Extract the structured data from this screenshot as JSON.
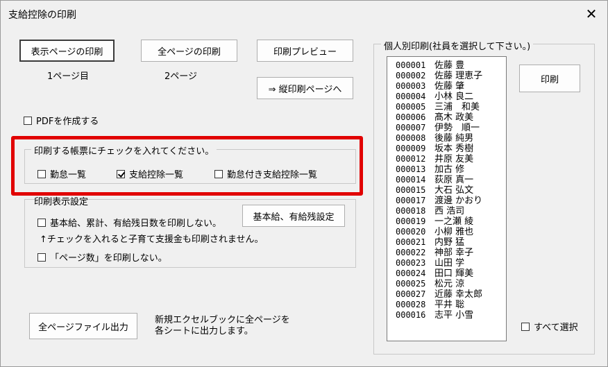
{
  "title": "支給控除の印刷",
  "buttons": {
    "print_displayed": "表示ページの印刷",
    "print_all": "全ページの印刷",
    "preview": "印刷プレビュー",
    "vertical": "⇒ 縦印刷ページへ",
    "print": "印刷",
    "basic_settings": "基本給、有給残設定",
    "export_all": "全ページファイル出力"
  },
  "page_info": {
    "displayed": "1ページ目",
    "total": "2ページ"
  },
  "pdf_checkbox": {
    "label": "PDFを作成する",
    "checked": false
  },
  "report_group": {
    "title": "印刷する帳票にチェックを入れてください。",
    "options": [
      {
        "label": "勤怠一覧",
        "checked": false
      },
      {
        "label": "支給控除一覧",
        "checked": true
      },
      {
        "label": "勤怠付き支給控除一覧",
        "checked": false
      }
    ]
  },
  "display_group": {
    "title": "印刷表示設定",
    "opt1": "基本給、累計、有給残日数を印刷しない。",
    "note": "↑チェックを入れると子育て支援金も印刷されません。",
    "opt2": "「ページ数」を印刷しない。"
  },
  "export_desc": {
    "line1": "新規エクセルブックに全ページを",
    "line2": "各シートに出力します。"
  },
  "employee_group": {
    "title": "個人別印刷(社員を選択して下さい。)",
    "select_all": "すべて選択",
    "employees": [
      {
        "code": "000001",
        "name": "佐藤 豊"
      },
      {
        "code": "000002",
        "name": "佐藤 理恵子"
      },
      {
        "code": "000003",
        "name": "佐藤 肇"
      },
      {
        "code": "000004",
        "name": "小林 良二"
      },
      {
        "code": "000005",
        "name": "三浦　和美"
      },
      {
        "code": "000006",
        "name": "髙木 政美"
      },
      {
        "code": "000007",
        "name": "伊勢　順一"
      },
      {
        "code": "000008",
        "name": "後藤 純男"
      },
      {
        "code": "000009",
        "name": "坂本 秀樹"
      },
      {
        "code": "000012",
        "name": "井原 友美"
      },
      {
        "code": "000013",
        "name": "加古 修"
      },
      {
        "code": "000014",
        "name": "荻原 真一"
      },
      {
        "code": "000015",
        "name": "大石 弘文"
      },
      {
        "code": "000017",
        "name": "渡邊 かおり"
      },
      {
        "code": "000018",
        "name": "西 浩司"
      },
      {
        "code": "000019",
        "name": "一之瀬 綾"
      },
      {
        "code": "000020",
        "name": "小柳 雅也"
      },
      {
        "code": "000021",
        "name": "内野 猛"
      },
      {
        "code": "000022",
        "name": "神部 幸子"
      },
      {
        "code": "000023",
        "name": "山田 学"
      },
      {
        "code": "000024",
        "name": "田口 輝美"
      },
      {
        "code": "000025",
        "name": "松元 涼"
      },
      {
        "code": "000027",
        "name": "近藤 幸太郎"
      },
      {
        "code": "000028",
        "name": "平井 聡"
      },
      {
        "code": "000016",
        "name": "志平 小雪"
      }
    ]
  },
  "colors": {
    "highlight": "#e10000",
    "background": "#f0f0f0"
  }
}
